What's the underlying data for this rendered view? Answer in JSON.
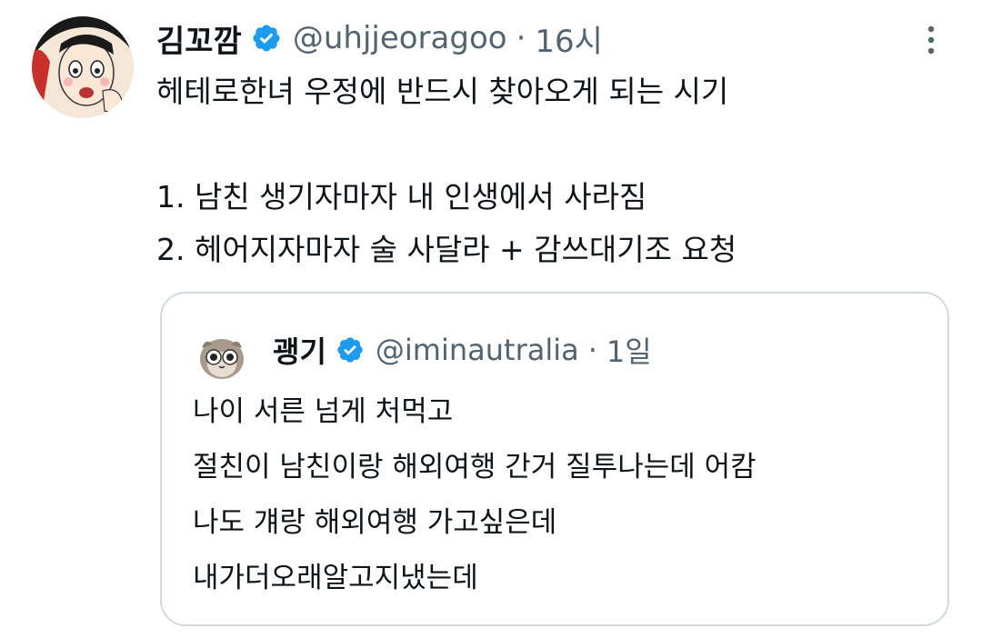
{
  "tweet": {
    "author_name": "김꼬깜",
    "handle": "@uhjjeoragoo",
    "separator": "·",
    "time": "16시",
    "verified_icon": "verified-badge-icon",
    "more_icon": "more-vertical-icon",
    "accent_color": "#1d9bf0",
    "text_lines": [
      "헤테로한녀 우정에 반드시 찾아오게 되는 시기",
      "",
      "1. 남친 생기자마자 내 인생에서 사라짐",
      "2. 헤어지자마자 술 사달라 + 감쓰대기조 요청"
    ]
  },
  "quote": {
    "author_name": "괭기",
    "handle": "@iminautralia",
    "separator": "·",
    "time": "1일",
    "verified_icon": "verified-badge-icon",
    "text_lines": [
      "나이 서른 넘게 처먹고",
      "절친이 남친이랑 해외여행 간거 질투나는데 어캄",
      "나도 걔랑 해외여행 가고싶은데",
      "내가더오래알고지냈는데"
    ]
  }
}
